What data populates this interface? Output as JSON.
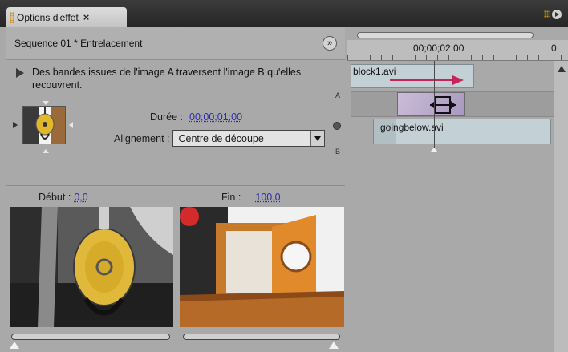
{
  "panel": {
    "tab_label": "Options d'effet",
    "close_glyph": "×"
  },
  "effect": {
    "sequence_title": "Sequence 01 * Entrelacement",
    "expand_glyph": "»",
    "description": "Des bandes issues de l'image A traversent l'image B qu'elles recouvrent.",
    "duration_label": "Durée :",
    "duration_value": "00;00;01;00",
    "alignment_label": "Alignement :",
    "alignment_value": "Centre de découpe",
    "letter_a": "A",
    "letter_b": "B"
  },
  "preview": {
    "start_label": "Début :",
    "start_value": "0,0",
    "end_label": "Fin :",
    "end_value": "100,0",
    "start_fraction": 0.0,
    "end_fraction": 1.0
  },
  "timeline": {
    "timecode": "00;00;02;00",
    "timecode_end": "0",
    "clip_a": "block1.avi",
    "clip_b": "goingbelow.avi"
  },
  "colors": {
    "accent_orange": "#d08a00",
    "link_blue": "#2c2cae",
    "clip_blue": "#c3d0d6",
    "transition_purple": "#b9a9cc",
    "arrow_red": "#c8245a"
  }
}
